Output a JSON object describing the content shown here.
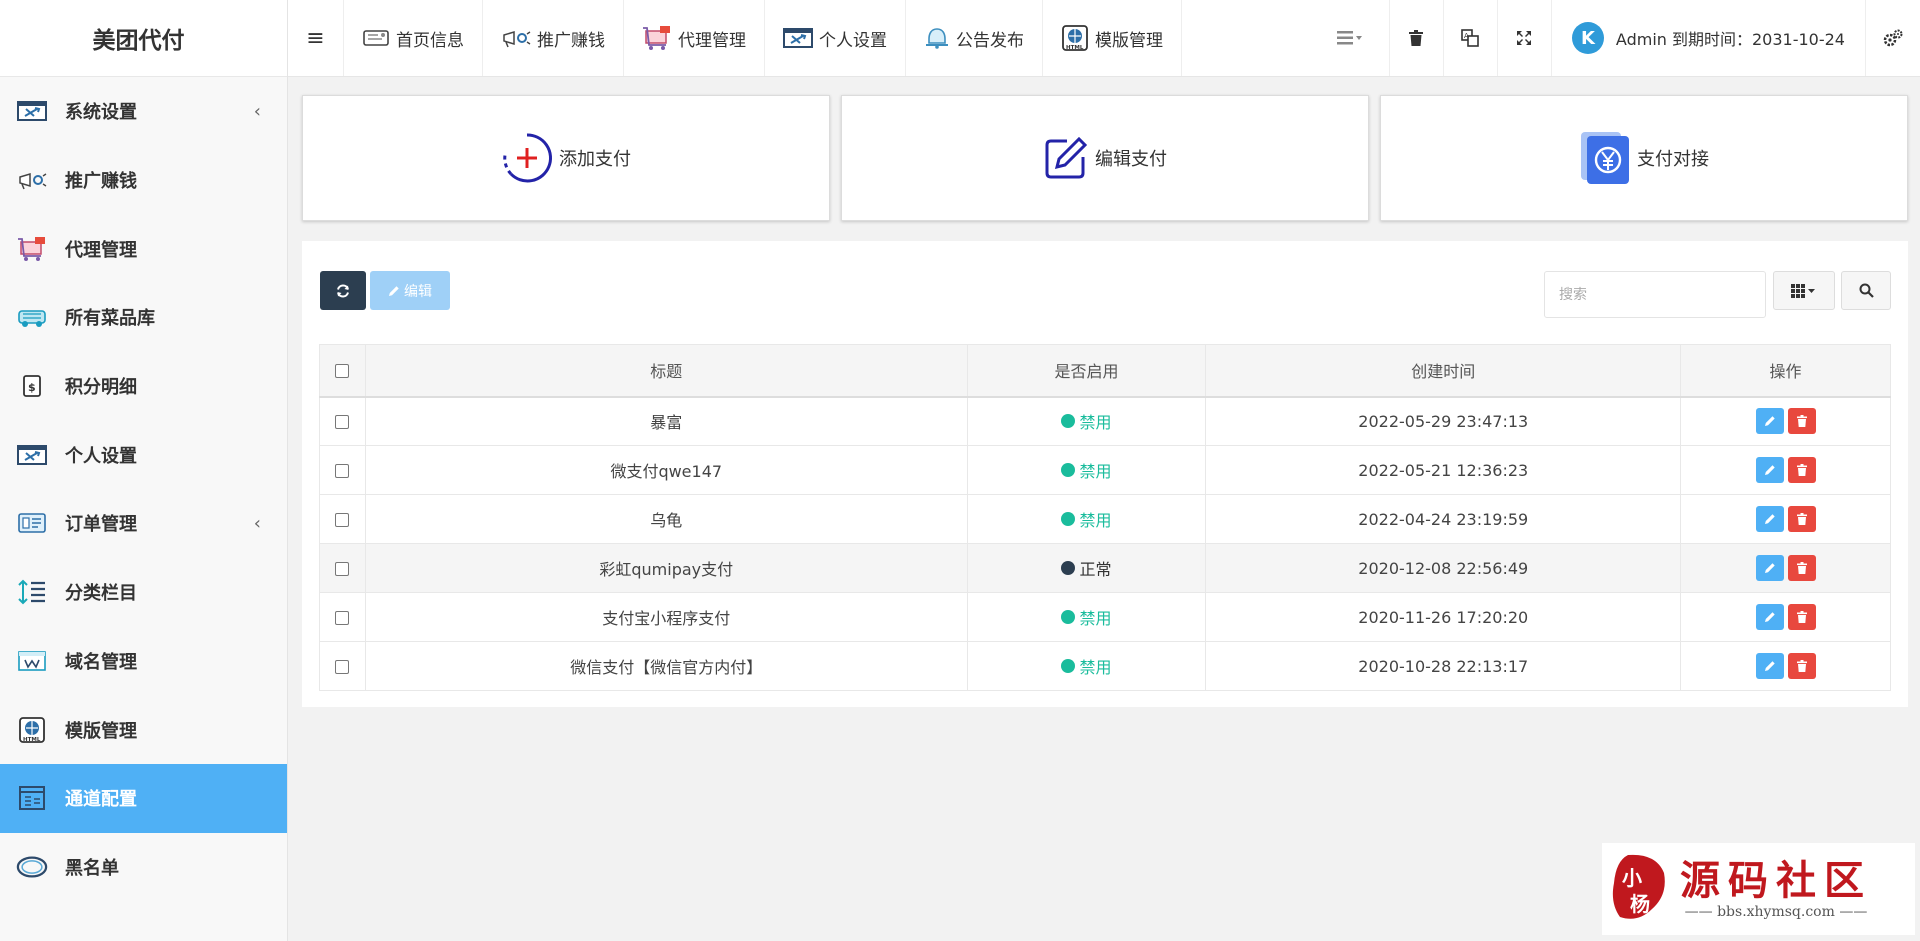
{
  "app": {
    "title": "美团代付"
  },
  "sidebar": {
    "items": [
      {
        "label": "系统设置",
        "icon": "system-settings-icon",
        "has_arrow": true
      },
      {
        "label": "推广赚钱",
        "icon": "promotion-icon"
      },
      {
        "label": "代理管理",
        "icon": "agent-icon"
      },
      {
        "label": "所有菜品库",
        "icon": "dishes-icon"
      },
      {
        "label": "积分明细",
        "icon": "points-icon"
      },
      {
        "label": "个人设置",
        "icon": "personal-settings-icon"
      },
      {
        "label": "订单管理",
        "icon": "orders-icon",
        "has_arrow": true
      },
      {
        "label": "分类栏目",
        "icon": "category-icon"
      },
      {
        "label": "域名管理",
        "icon": "domain-icon"
      },
      {
        "label": "模版管理",
        "icon": "template-icon"
      },
      {
        "label": "通道配置",
        "icon": "channel-icon",
        "active": true
      },
      {
        "label": "黑名单",
        "icon": "blacklist-icon"
      }
    ],
    "arrow_glyph": "‹",
    "active_color": "#4fb0f5"
  },
  "topnav": {
    "menu_icon": "≡",
    "items": [
      {
        "label": "首页信息",
        "icon": "home-info-icon"
      },
      {
        "label": "推广赚钱",
        "icon": "promotion-icon"
      },
      {
        "label": "代理管理",
        "icon": "agent-icon"
      },
      {
        "label": "个人设置",
        "icon": "personal-settings-icon"
      },
      {
        "label": "公告发布",
        "icon": "announcement-icon"
      },
      {
        "label": "模版管理",
        "icon": "template-icon"
      }
    ],
    "user": {
      "avatar_letter": "K",
      "text": "Admin 到期时间：2031-10-24"
    }
  },
  "quick_cards": [
    {
      "label": "添加支付",
      "icon": "add-circle-icon"
    },
    {
      "label": "编辑支付",
      "icon": "edit-pen-icon"
    },
    {
      "label": "支付对接",
      "icon": "yuan-book-icon"
    }
  ],
  "toolbar": {
    "edit_label": "编辑",
    "search_placeholder": "搜索"
  },
  "table": {
    "columns": [
      "标题",
      "是否启用",
      "创建时间",
      "操作"
    ],
    "rows": [
      {
        "title": "暴富",
        "status": "禁用",
        "status_color": "#1abc9c",
        "created": "2022-05-29 23:47:13"
      },
      {
        "title": "微支付qwe147",
        "status": "禁用",
        "status_color": "#1abc9c",
        "created": "2022-05-21 12:36:23"
      },
      {
        "title": "乌龟",
        "status": "禁用",
        "status_color": "#1abc9c",
        "created": "2022-04-24 23:19:59"
      },
      {
        "title": "彩虹qumipay支付",
        "status": "正常",
        "status_color": "#2c3e50",
        "created": "2020-12-08 22:56:49",
        "highlight": true
      },
      {
        "title": "支付宝小程序支付",
        "status": "禁用",
        "status_color": "#1abc9c",
        "created": "2020-11-26 17:20:20"
      },
      {
        "title": "微信支付【微信官方内付】",
        "status": "禁用",
        "status_color": "#1abc9c",
        "created": "2020-10-28 22:13:17"
      }
    ]
  },
  "watermark": {
    "title": "源码社区",
    "subtitle": "—— bbs.xhymsq.com ——",
    "seal_text": "小杨"
  }
}
